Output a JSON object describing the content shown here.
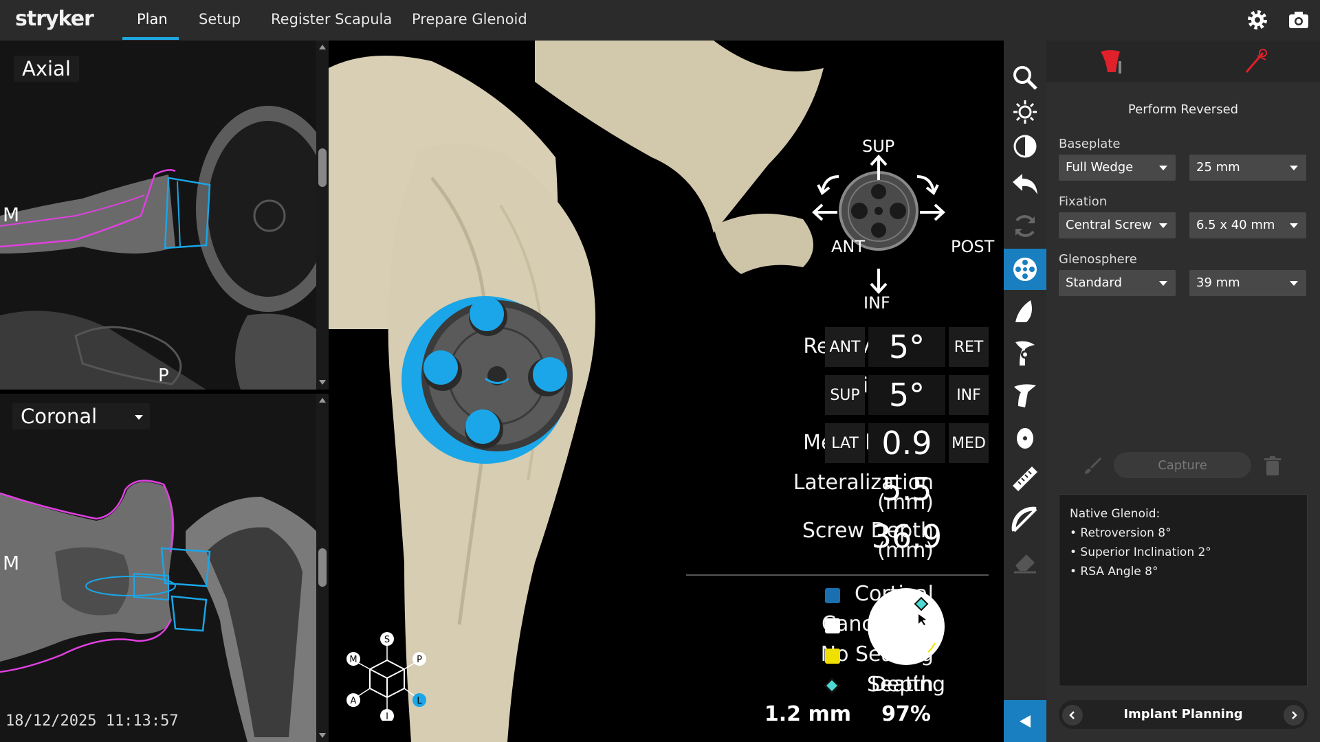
{
  "app": {
    "logo": "stryker"
  },
  "nav": {
    "tabs": [
      {
        "label": "Plan"
      },
      {
        "label": "Setup"
      },
      {
        "label": "Register Scapula"
      },
      {
        "label": "Prepare Glenoid"
      }
    ]
  },
  "scans": {
    "axial": {
      "label": "Axial",
      "left_marker": "M",
      "bottom_marker": "P"
    },
    "coronal": {
      "label": "Coronal",
      "left_marker": "M"
    },
    "timestamp": "18/12/2025 11:13:57"
  },
  "directions": {
    "up": "SUP",
    "down": "INF",
    "left": "ANT",
    "right": "POST"
  },
  "measurements": {
    "retroversion": {
      "label": "Retroversion",
      "left": "ANT",
      "value": "5°",
      "right": "RET"
    },
    "inclination": {
      "label_line1": "Inclination",
      "label_line2": "Inf",
      "left": "SUP",
      "value": "5°",
      "right": "INF"
    },
    "medial": {
      "label": "Medial (mm)",
      "left": "LAT",
      "value": "0.9",
      "right": "MED"
    },
    "lateralization": {
      "label_line1": "Lateralization",
      "label_line2": "(mm)",
      "value": "5.5"
    },
    "screw_depth": {
      "label_line1": "Screw Depth",
      "label_line2": "(mm)",
      "value": "36.9"
    }
  },
  "legend": {
    "items": [
      {
        "label": "Cortical",
        "color": "#1a6fb0"
      },
      {
        "label": "Cancellous",
        "color": "#ffffff"
      },
      {
        "label": "No Seating",
        "color": "#f0e000"
      },
      {
        "label": "Depth",
        "color": "#4dd8d0"
      }
    ],
    "depth_value": "1.2 mm",
    "seating_label": "Seating",
    "seating_value": "97%"
  },
  "orientation_cube": {
    "labels": [
      "S",
      "M",
      "P",
      "A",
      "L",
      "I"
    ]
  },
  "right_panel": {
    "title": "Perform Reversed",
    "baseplate": {
      "label": "Baseplate",
      "type": "Full Wedge",
      "size": "25 mm"
    },
    "fixation": {
      "label": "Fixation",
      "type": "Central Screw",
      "size": "6.5 x 40 mm"
    },
    "glenosphere": {
      "label": "Glenosphere",
      "type": "Standard",
      "size": "39 mm"
    },
    "capture_label": "Capture",
    "notes": [
      "Native Glenoid:",
      "• Retroversion 8°",
      "• Superior Inclination 2°",
      "• RSA Angle 8°"
    ],
    "footer": "Implant Planning"
  },
  "colors": {
    "accent": "#1a7fc1",
    "implant_blue": "#1aa6e8",
    "outline_magenta": "#e040e0",
    "bone": "#d6cdb2"
  }
}
